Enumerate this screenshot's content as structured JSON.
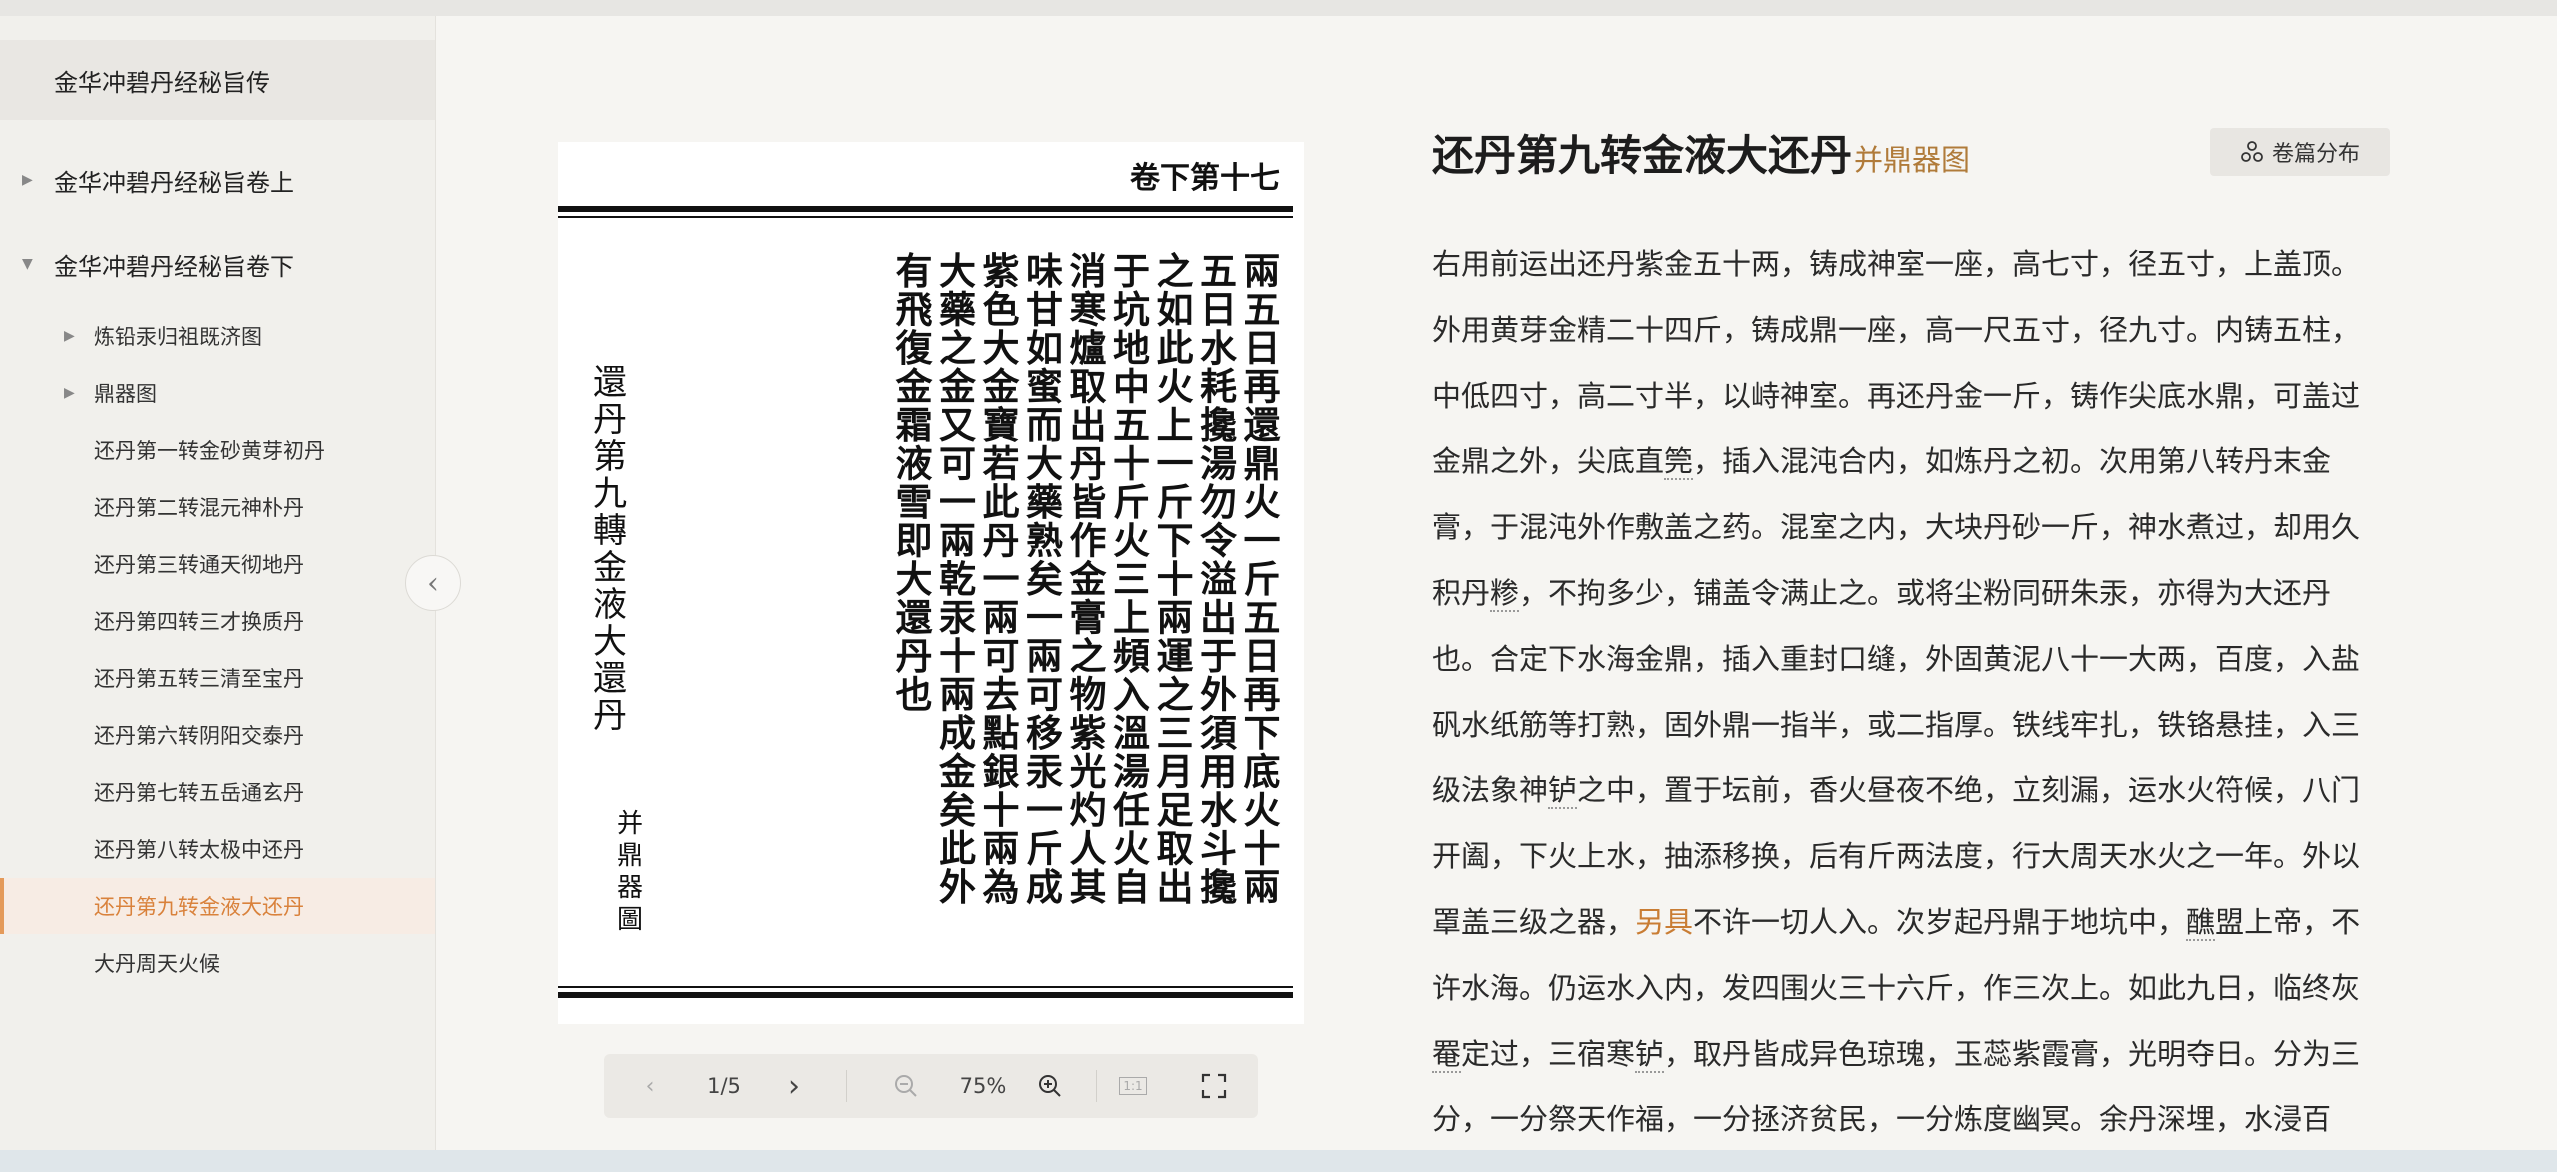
{
  "sidebar": {
    "items": [
      {
        "label": "金华冲碧丹经秘旨传"
      },
      {
        "label": "金华冲碧丹经秘旨卷上"
      },
      {
        "label": "金华冲碧丹经秘旨卷下"
      },
      {
        "label": "炼铅汞归祖既济图"
      },
      {
        "label": "鼎器图"
      },
      {
        "label": "还丹第一转金砂黄芽初丹"
      },
      {
        "label": "还丹第二转混元神朴丹"
      },
      {
        "label": "还丹第三转通天彻地丹"
      },
      {
        "label": "还丹第四转三才换质丹"
      },
      {
        "label": "还丹第五转三清至宝丹"
      },
      {
        "label": "还丹第六转阴阳交泰丹"
      },
      {
        "label": "还丹第七转五岳通玄丹"
      },
      {
        "label": "还丹第八转太极中还丹"
      },
      {
        "label": "还丹第九转金液大还丹"
      },
      {
        "label": "大丹周天火候"
      }
    ],
    "collapse_icon": "chevron-left-icon"
  },
  "viewer": {
    "header": "卷下第十七",
    "columns": [
      "兩五日再還鼎火一斤五日再下底火十兩",
      "五日水耗攙湯勿令溢出于外須用水斗攙",
      "之如此火上一斤下十兩運之三月足取出",
      "于坑地中五十斤火三上頻入溫湯任火自",
      "消寒爐取出丹皆作金膏之物紫光灼人其",
      "味甘如蜜而大藥熟矣一兩可移汞一斤成",
      "紫色大金寶若此丹一兩可去點銀十兩為",
      "大藥之金又可一兩乾汞十兩成金矣此外",
      "有飛復金霜液雪即大還丹也"
    ],
    "caption": "還丹第九轉金液大還丹",
    "caption_small": "并鼎器圖",
    "toolbar": {
      "page": "1/5",
      "zoom": "75%",
      "one_to_one": "1:1"
    }
  },
  "article": {
    "title": "还丹第九转金液大还丹",
    "title_link": "并鼎器图",
    "distribution_button": "卷篇分布",
    "lines": [
      [
        {
          "t": "右用前运出还丹紫金五十两，铸成神室一座，高七寸，径五寸，上盖顶。"
        }
      ],
      [
        {
          "t": "外用黄芽金精二十四斤，铸成鼎一座，高一尺五寸，径九寸。内铸五柱，"
        }
      ],
      [
        {
          "t": "中低四寸，高二寸半，以峙神室。再还丹金一斤，铸作尖底水鼎，可盖过"
        }
      ],
      [
        {
          "t": "金鼎之外，尖底直"
        },
        {
          "t": "筦",
          "n": 1
        },
        {
          "t": "，插入混沌合内，如炼丹之初。次用第八转丹末金"
        }
      ],
      [
        {
          "t": "膏，于混沌外作敷盖之药。混室之内，大块丹砂一斤，神水煮过，却用久"
        }
      ],
      [
        {
          "t": "积丹"
        },
        {
          "t": "糁",
          "n": 1
        },
        {
          "t": "，不拘多少，铺盖令满止之。或将尘粉同研朱汞，亦得为大还丹"
        }
      ],
      [
        {
          "t": "也。合定下水海金鼎，插入重封口缝，外固黄泥八十一大两，百度，入盐"
        }
      ],
      [
        {
          "t": "矾水纸筋等打熟，固外鼎一指半，或二指厚。铁线牢扎，铁铬悬挂，入三"
        }
      ],
      [
        {
          "t": "级法象神"
        },
        {
          "t": "𬬻",
          "n": 1
        },
        {
          "t": "之中，置于坛前，香火昼夜不绝，立刻漏，运水火符候，八门"
        }
      ],
      [
        {
          "t": "开阖，下火上水，抽添移换，后有斤两法度，行大周天水火之一年。外以"
        }
      ],
      [
        {
          "t": "罩盖三级之器，"
        },
        {
          "t": "另具",
          "a": 1
        },
        {
          "t": "不许一切人入。次岁起丹鼎于地坑中，"
        },
        {
          "t": "醮",
          "n": 1
        },
        {
          "t": "盟上帝，不"
        }
      ],
      [
        {
          "t": "许水海。仍运水入内，发四围火三十六斤，作三次上。如此九日，临终灰"
        }
      ],
      [
        {
          "t": "罨",
          "n": 1
        },
        {
          "t": "定过，三宿寒"
        },
        {
          "t": "𬬻",
          "n": 1
        },
        {
          "t": "，取丹皆成异色琼瑰，玉蕊紫霞膏，光明夺日。分为三"
        }
      ],
      [
        {
          "t": "分，一分祭天作福，一分拯济贫民，一分炼度幽冥。余丹深埋，水浸百"
        }
      ]
    ]
  },
  "colors": {
    "accent": "#d9823c",
    "link": "#b07b3a",
    "sidebar_bg": "#f1f0ec",
    "page_bg": "#f6f5f2"
  }
}
